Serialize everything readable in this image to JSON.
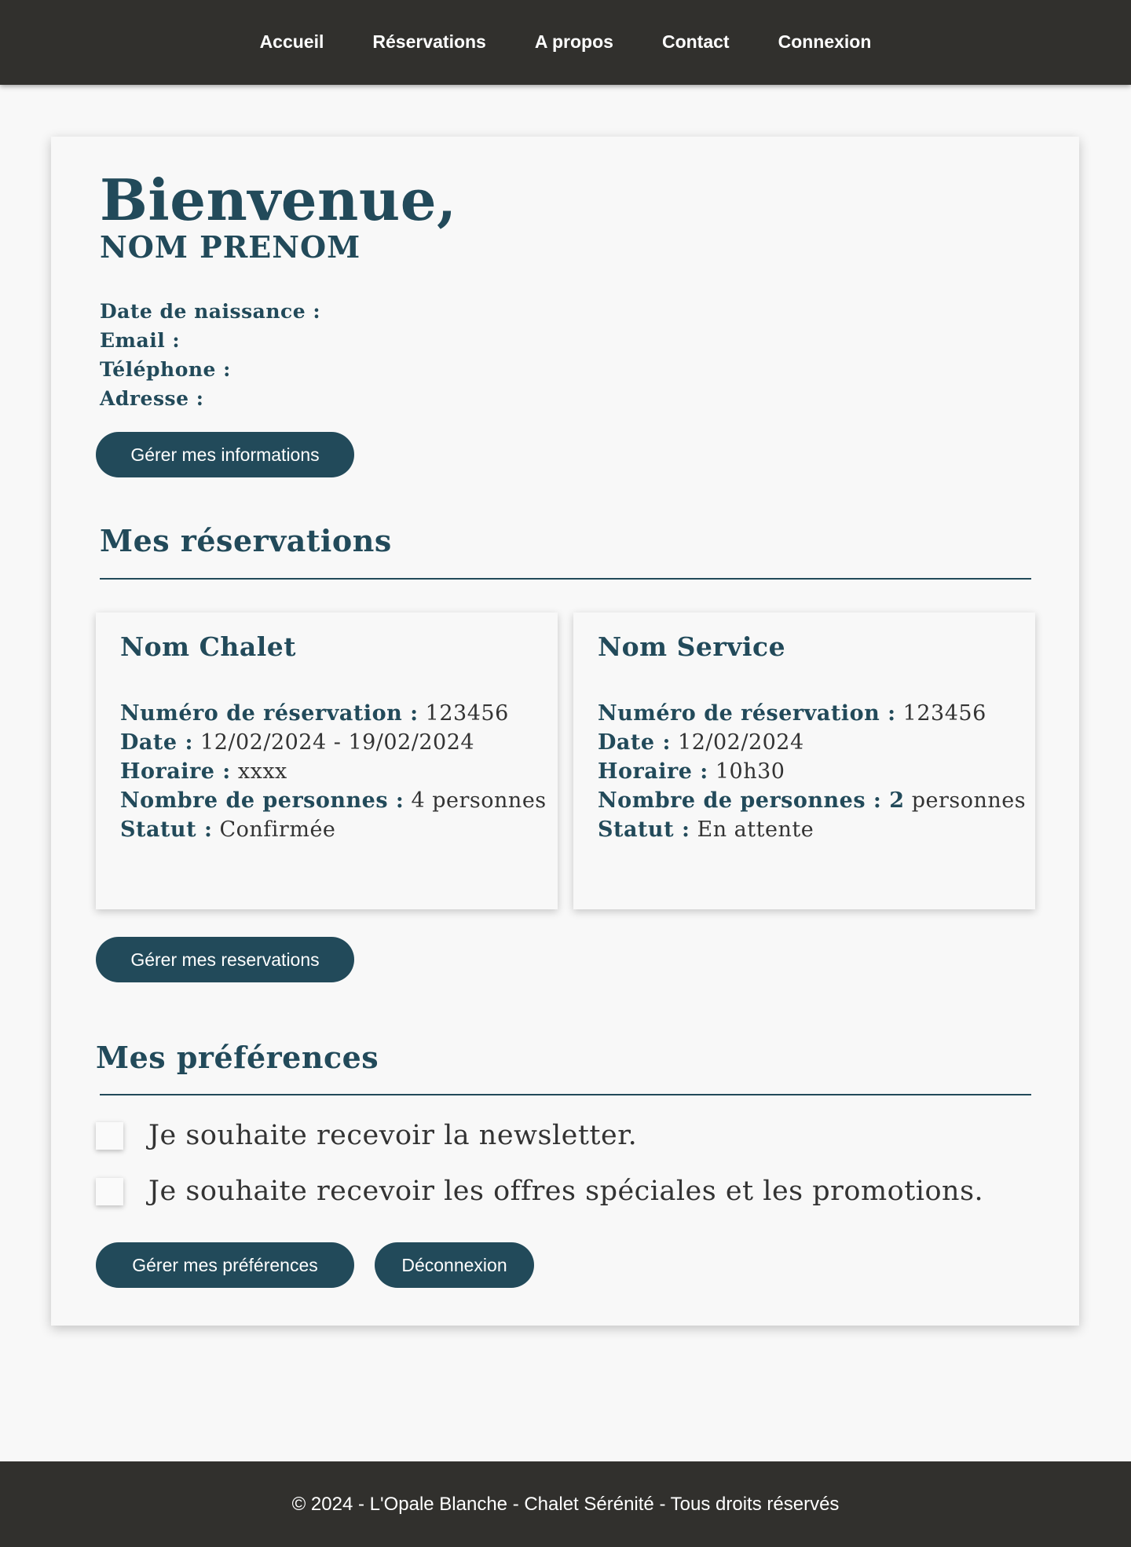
{
  "nav": {
    "items": [
      "Accueil",
      "Réservations",
      "A propos",
      "Contact",
      "Connexion"
    ]
  },
  "welcome": {
    "title": "Bienvenue,",
    "name": "NOM PRENOM"
  },
  "info": {
    "birthdate_label": "Date de naissance :",
    "email_label": "Email :",
    "phone_label": "Téléphone :",
    "address_label": "Adresse :",
    "manage_info_button": "Gérer mes informations"
  },
  "reservations": {
    "title": "Mes réservations",
    "cards": [
      {
        "title": "Nom Chalet",
        "number_label": "Numéro de réservation :",
        "number_value": "123456",
        "date_label": "Date :",
        "date_value": "12/02/2024 - 19/02/2024",
        "time_label": "Horaire :",
        "time_value": "xxxx",
        "people_label": "Nombre de personnes :",
        "people_value": "4 personnes",
        "status_label": "Statut :",
        "status_value": "Confirmée"
      },
      {
        "title": "Nom Service",
        "number_label": "Numéro de réservation :",
        "number_value": "123456",
        "date_label": "Date :",
        "date_value": "12/02/2024",
        "time_label": "Horaire :",
        "time_value": "10h30",
        "people_label": "Nombre de personnes : 2",
        "people_value": "personnes",
        "status_label": "Statut :",
        "status_value": "En attente"
      }
    ],
    "manage_button": "Gérer mes reservations"
  },
  "preferences": {
    "title": "Mes préférences",
    "options": [
      {
        "label": "Je souhaite recevoir la newsletter.",
        "checked": false
      },
      {
        "label": "Je souhaite recevoir les offres spéciales et les promotions.",
        "checked": false
      }
    ],
    "manage_button": "Gérer mes préférences",
    "logout_button": "Déconnexion"
  },
  "footer": {
    "text": "© 2024 - L'Opale Blanche - Chalet Sérénité - Tous droits réservés"
  },
  "colors": {
    "primary": "#224a5a",
    "bar": "#31302d",
    "background": "#f8f8f8"
  }
}
